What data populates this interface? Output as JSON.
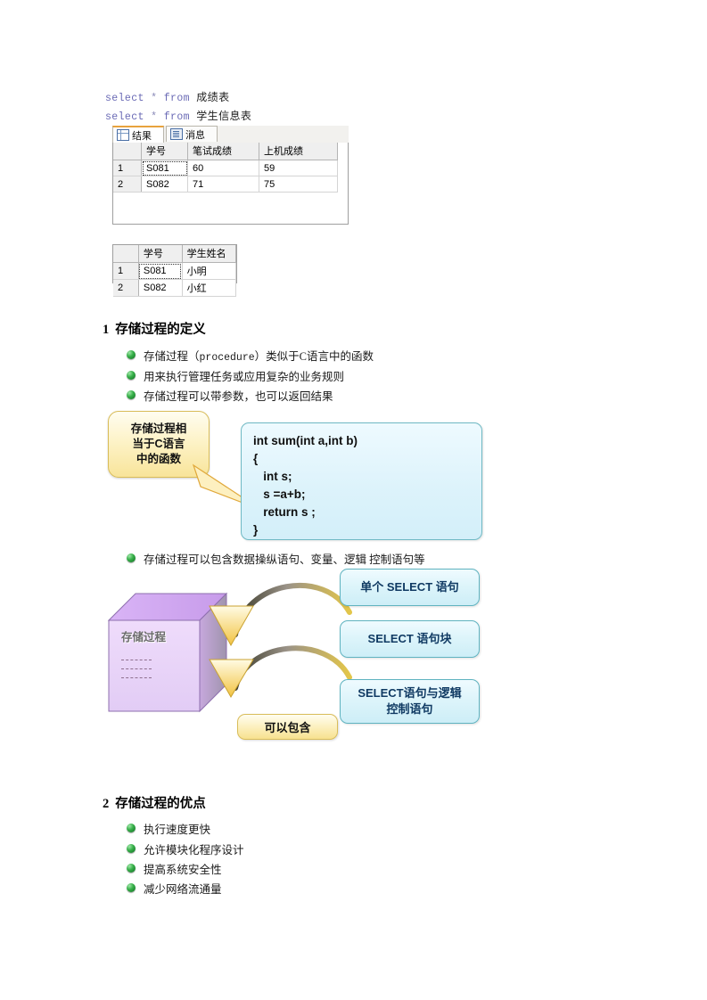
{
  "sql": {
    "line1": {
      "keyword": "select",
      "star": "*",
      "from": "from",
      "table": "成绩表"
    },
    "line2": {
      "keyword": "select",
      "star": "*",
      "from": "from",
      "table": "学生信息表"
    }
  },
  "results_pane": {
    "tabs": [
      {
        "label": "结果",
        "icon": "grid-icon",
        "active": true
      },
      {
        "label": "消息",
        "icon": "message-icon",
        "active": false
      }
    ],
    "grid1": {
      "columns": [
        "学号",
        "笔试成绩",
        "上机成绩"
      ],
      "rows": [
        {
          "num": "1",
          "cells": [
            "S081",
            "60",
            "59"
          ]
        },
        {
          "num": "2",
          "cells": [
            "S082",
            "71",
            "75"
          ]
        }
      ]
    },
    "grid2": {
      "columns": [
        "学号",
        "学生姓名"
      ],
      "rows": [
        {
          "num": "1",
          "cells": [
            "S081",
            "小明"
          ]
        },
        {
          "num": "2",
          "cells": [
            "S082",
            "小红"
          ]
        }
      ]
    }
  },
  "section1": {
    "number": "1",
    "title": "存储过程的定义",
    "bullets": [
      {
        "pre": "存储过程（",
        "mono": "procedure",
        "post": "）类似于C语言中的函数"
      },
      {
        "text": "用来执行管理任务或应用复杂的业务规则"
      },
      {
        "text": "存储过程可以带参数，也可以返回结果"
      }
    ],
    "callout": {
      "line1": "存储过程相",
      "line2": "当于C语言",
      "line3": "中的函数"
    },
    "code": "int sum(int a,int b)\n{\n   int s;\n   s =a+b;\n   return s ;\n}",
    "bullet4": "存储过程可以包含数据操纵语句、变量、逻辑 控制语句等"
  },
  "diagram": {
    "cube_label": "存储过程",
    "include_label": "可以包含",
    "boxes": [
      {
        "text": "单个 SELECT 语句"
      },
      {
        "text": "SELECT 语句块"
      },
      {
        "line1": "SELECT语句与逻辑",
        "line2": "控制语句"
      }
    ],
    "colors": {
      "cube_front": "#e7d4f5",
      "cube_top": "#cfa6ef",
      "box_fill": "#dcf4fa",
      "callout_fill": "#f8e49a"
    }
  },
  "section2": {
    "number": "2",
    "title": "存储过程的优点",
    "bullets": [
      {
        "text": "执行速度更快"
      },
      {
        "text": "允许模块化程序设计"
      },
      {
        "text": "提高系统安全性"
      },
      {
        "text": "减少网络流通量"
      }
    ]
  }
}
